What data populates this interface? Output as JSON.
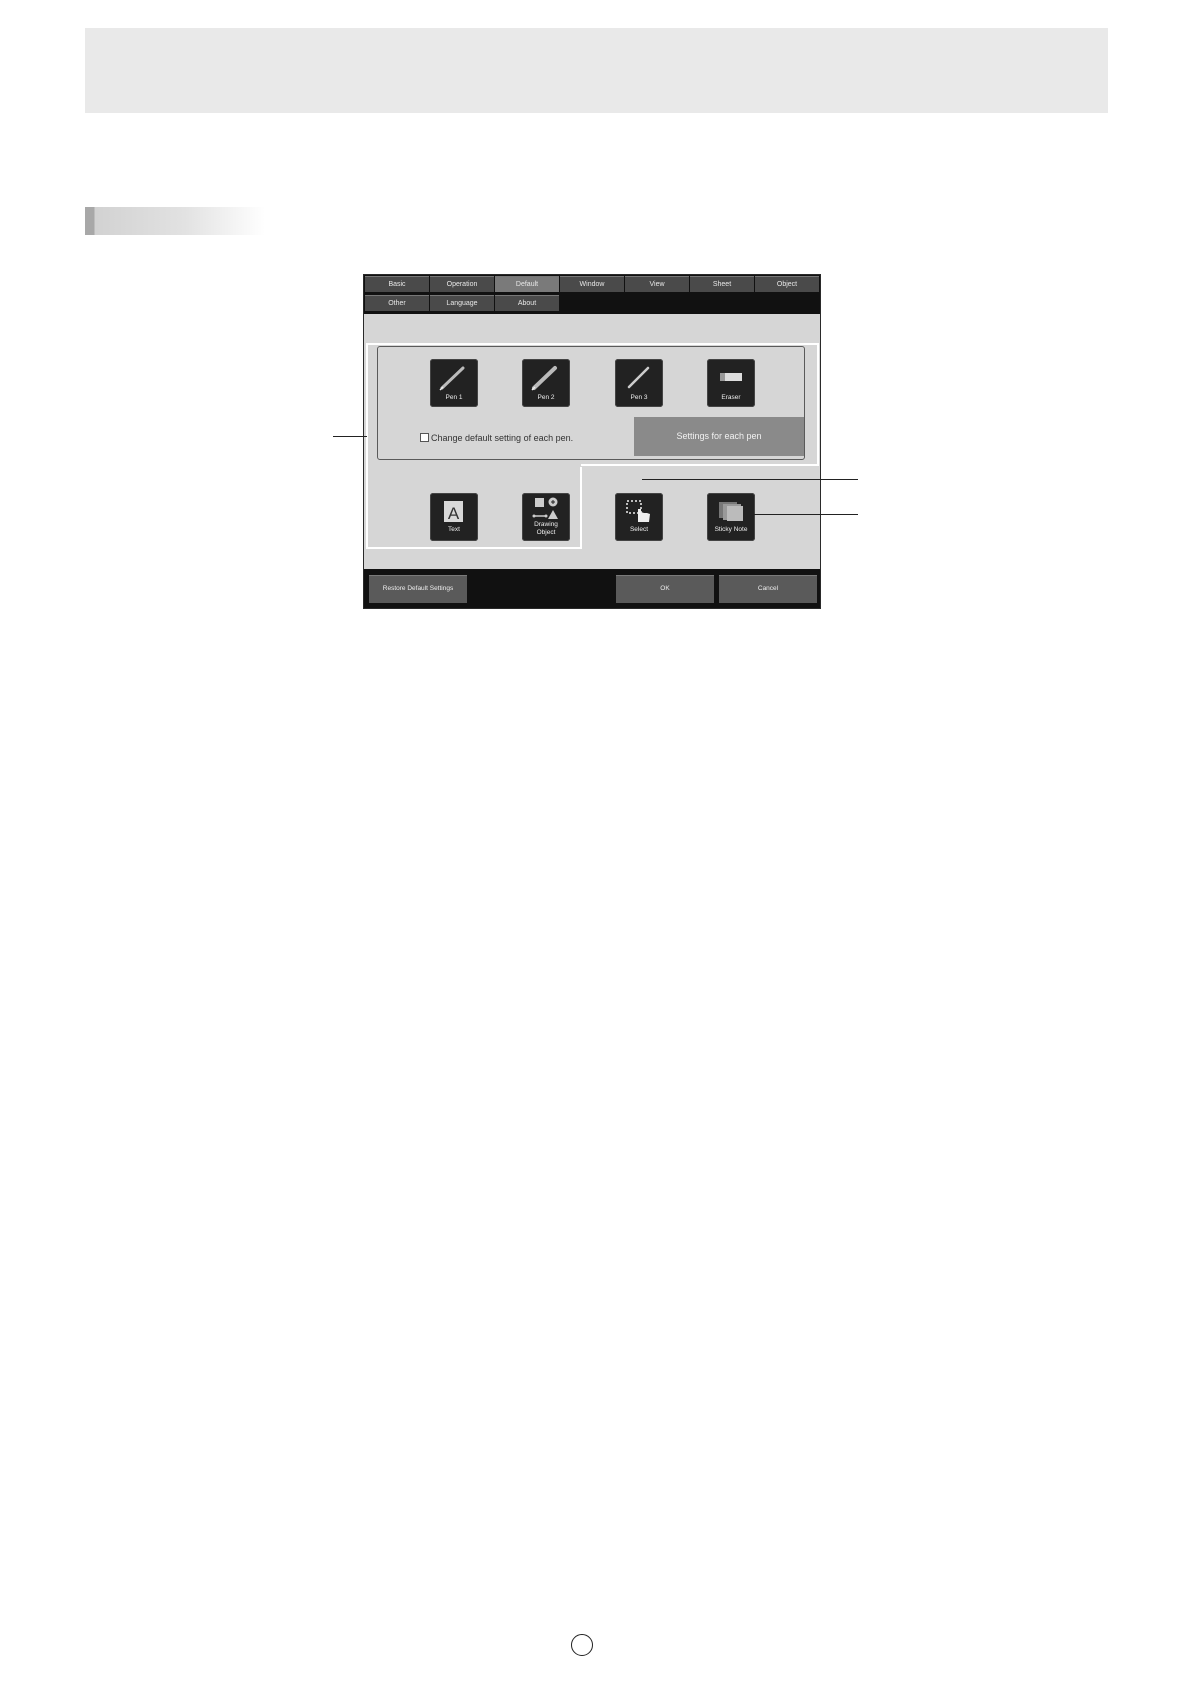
{
  "tabs_row1": [
    "Basic",
    "Operation",
    "Default",
    "Window",
    "View",
    "Sheet",
    "Object"
  ],
  "tabs_row2": [
    "Other",
    "Language",
    "About"
  ],
  "active_tab": "Default",
  "pen_tools": [
    {
      "label": "Pen 1",
      "icon": "pen-icon"
    },
    {
      "label": "Pen 2",
      "icon": "pen-icon"
    },
    {
      "label": "Pen 3",
      "icon": "pen-icon"
    },
    {
      "label": "Eraser",
      "icon": "eraser-icon"
    }
  ],
  "other_tools": [
    {
      "label_lines": [
        "Text"
      ],
      "icon": "text-icon"
    },
    {
      "label_lines": [
        "Drawing",
        "Object"
      ],
      "icon": "drawing-object-icon"
    },
    {
      "label_lines": [
        "Select"
      ],
      "icon": "select-icon"
    },
    {
      "label_lines": [
        "Sticky Note"
      ],
      "icon": "sticky-note-icon"
    }
  ],
  "checkbox": {
    "label": "Change default setting of each pen.",
    "checked": false
  },
  "settings_button": "Settings for each pen",
  "bottom_buttons": {
    "restore": "Restore Default Settings",
    "ok": "OK",
    "cancel": "Cancel"
  }
}
